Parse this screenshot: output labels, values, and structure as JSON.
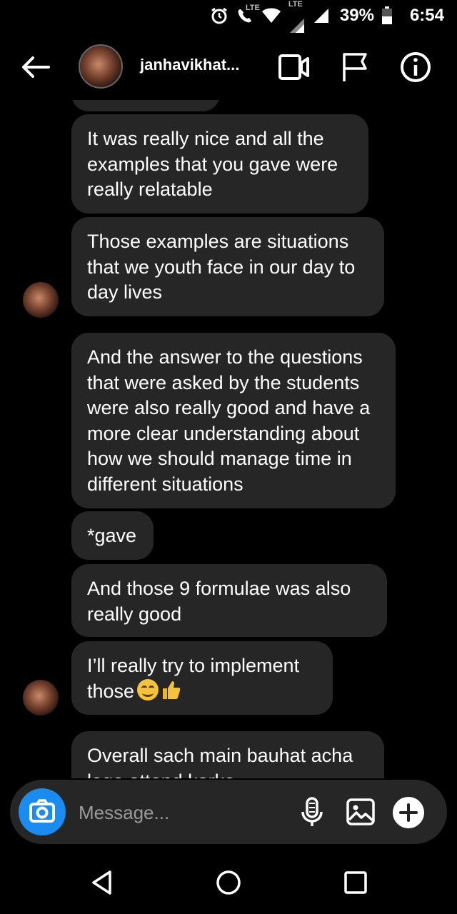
{
  "status": {
    "lte_label": "LTE",
    "lte_label2": "LTE",
    "battery": "39%",
    "time": "6:54"
  },
  "header": {
    "username": "janhavikhat...",
    "icons": {
      "back": "back-arrow-icon",
      "video": "video-call-icon",
      "flag": "flag-icon",
      "info": "info-icon"
    }
  },
  "messages": [
    {
      "text": "It was really nice and all the examples that you gave were really relatable"
    },
    {
      "text": "Those examples are situations that we youth face in our day to day lives"
    },
    {
      "text": "And the answer to the questions that were asked by the students were also really good and have a more clear understanding about how we should manage time in different situations"
    },
    {
      "text": "*gave"
    },
    {
      "text": "And those 9 formulae was also really good"
    },
    {
      "text": "I’ll really try to implement those"
    },
    {
      "text": "Overall sach main bauhat acha lage attend karke"
    }
  ],
  "composer": {
    "placeholder": "Message..."
  },
  "colors": {
    "bubble": "#262626",
    "background": "#000000",
    "camera_button": "#1a8cf0"
  }
}
